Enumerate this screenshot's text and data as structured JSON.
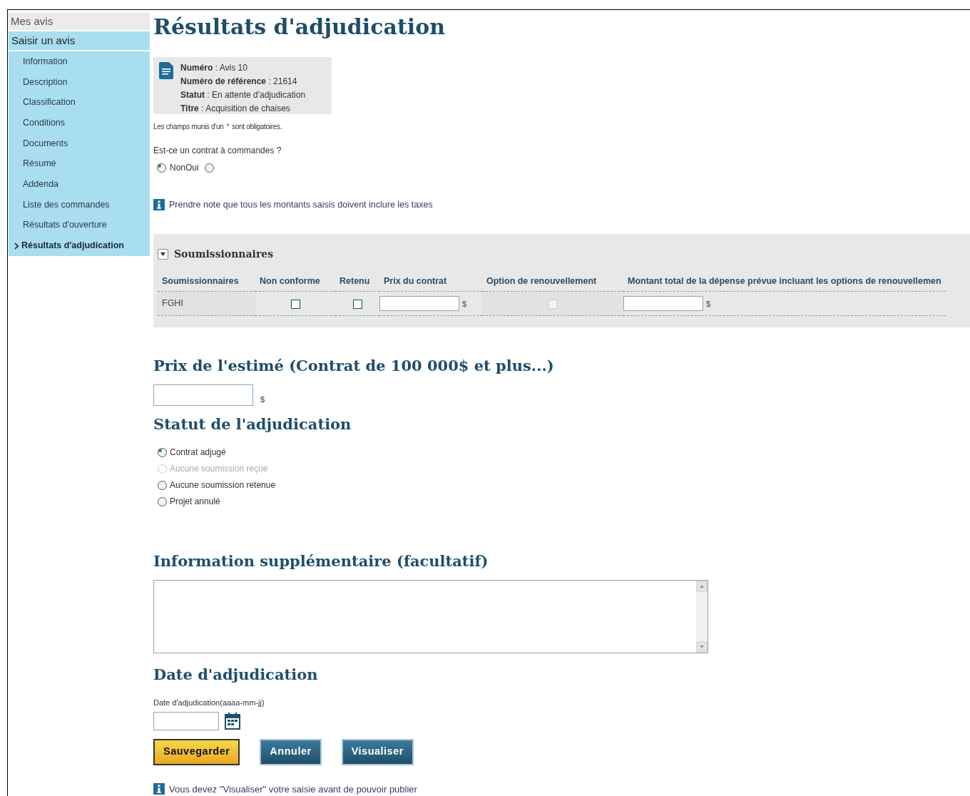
{
  "sidebar": {
    "items": [
      {
        "label": "Mes avis",
        "kind": "top",
        "selected": false
      },
      {
        "label": "Saisir un avis",
        "kind": "section",
        "selected": false
      },
      {
        "label": "Information",
        "kind": "sub",
        "selected": false
      },
      {
        "label": "Description",
        "kind": "sub",
        "selected": false
      },
      {
        "label": "Classification",
        "kind": "sub",
        "selected": false
      },
      {
        "label": "Conditions",
        "kind": "sub",
        "selected": false
      },
      {
        "label": "Documents",
        "kind": "sub",
        "selected": false
      },
      {
        "label": "Résumé",
        "kind": "sub",
        "selected": false
      },
      {
        "label": "Addenda",
        "kind": "sub",
        "selected": false
      },
      {
        "label": "Liste des commandes",
        "kind": "sub",
        "selected": false
      },
      {
        "label": "Résultats d'ouverture",
        "kind": "sub",
        "selected": false
      },
      {
        "label": "Résultats d'adjudication",
        "kind": "sub",
        "selected": true
      }
    ]
  },
  "page_title": "Résultats d'adjudication",
  "notice_summary": [
    "**Numéro** : Avis 10",
    "**Numéro de référence** : 21614",
    "**Statut** : En attente d'adjudication",
    "**Titre** : Acquisition de chaises"
  ],
  "required_note": {
    "before": "Les champs munis d'un",
    "mark": "*",
    "after": "sont obligatoires."
  },
  "order_contract": {
    "question": "Est-ce un contrat à commandes ?",
    "options": [
      {
        "label": "Non",
        "selected": true
      },
      {
        "label": "Oui",
        "selected": false
      }
    ]
  },
  "tax_note": "Prendre note que tous les montants saisis doivent inclure les taxes",
  "bidders": {
    "title": "Soumissionnaires",
    "expanded": true,
    "columns": [
      "Soumissionnaires",
      "Non conforme",
      "Retenu",
      "Prix du contrat",
      "Option de renouvellement",
      "Montant total de la dépense prévue incluant les options de renouvellemen"
    ],
    "rows": [
      {
        "name": "FGHI",
        "non_conforme": false,
        "retenu": false,
        "prix_unit": "$",
        "renewal_disabled": true,
        "total_unit": "$"
      }
    ]
  },
  "estimate": {
    "title": "Prix de l'estimé (Contrat de 100 000$ et plus...)",
    "unit": "$"
  },
  "status": {
    "title": "Statut de l'adjudication",
    "options": [
      {
        "label": "Contrat adjugé",
        "selected": true,
        "disabled": false
      },
      {
        "label": "Aucune soumission reçue",
        "selected": false,
        "disabled": true
      },
      {
        "label": "Aucune soumission retenue",
        "selected": false,
        "disabled": false
      },
      {
        "label": "Projet annulé",
        "selected": false,
        "disabled": false
      }
    ]
  },
  "extra_info": {
    "title": "Information supplémentaire (facultatif)"
  },
  "award_date": {
    "title": "Date d'adjudication",
    "label": "Date d'adjudication(aaaa-mm-jj)"
  },
  "buttons": [
    {
      "label": "Sauvegarder",
      "kind": "primary"
    },
    {
      "label": "Annuler",
      "kind": "secondary"
    },
    {
      "label": "Visualiser",
      "kind": "secondary"
    }
  ],
  "publish_note": "Vous devez \"Visualiser\" votre saisie avant de pouvoir publier"
}
